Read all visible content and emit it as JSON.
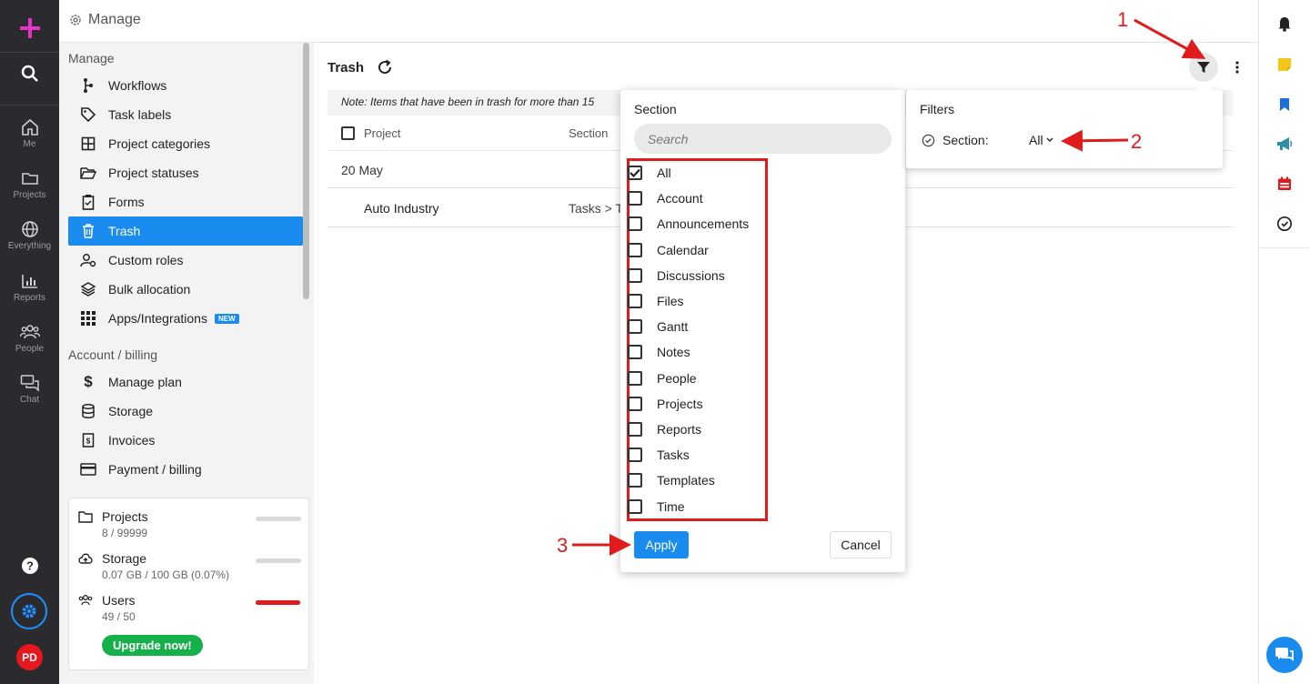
{
  "topbar": {
    "title": "Manage"
  },
  "rail": {
    "items": [
      {
        "label": "Me",
        "icon": "home-icon"
      },
      {
        "label": "Projects",
        "icon": "folder-icon"
      },
      {
        "label": "Everything",
        "icon": "globe-icon"
      },
      {
        "label": "Reports",
        "icon": "bar-chart-icon"
      },
      {
        "label": "People",
        "icon": "people-icon"
      },
      {
        "label": "Chat",
        "icon": "chat-icon"
      }
    ],
    "avatar": "PD"
  },
  "sidebar": {
    "heading_manage": "Manage",
    "manage_items": [
      {
        "label": "Workflows",
        "icon": "workflow-icon"
      },
      {
        "label": "Task labels",
        "icon": "tag-icon"
      },
      {
        "label": "Project categories",
        "icon": "grid-icon"
      },
      {
        "label": "Project statuses",
        "icon": "folder-open-icon"
      },
      {
        "label": "Forms",
        "icon": "clipboard-icon"
      },
      {
        "label": "Trash",
        "icon": "trash-icon"
      },
      {
        "label": "Custom roles",
        "icon": "user-role-icon"
      },
      {
        "label": "Bulk allocation",
        "icon": "layers-icon"
      },
      {
        "label": "Apps/Integrations",
        "icon": "apps-icon",
        "badge": "NEW"
      }
    ],
    "heading_billing": "Account / billing",
    "billing_items": [
      {
        "label": "Manage plan",
        "icon": "dollar-icon"
      },
      {
        "label": "Storage",
        "icon": "database-icon"
      },
      {
        "label": "Invoices",
        "icon": "invoice-icon"
      },
      {
        "label": "Payment / billing",
        "icon": "credit-card-icon"
      }
    ],
    "usage": {
      "projects": {
        "label": "Projects",
        "value": "8 / 99999",
        "fill": 0.0001
      },
      "storage": {
        "label": "Storage",
        "value": "0.07 GB / 100 GB (0.07%)",
        "fill": 0.0007
      },
      "users": {
        "label": "Users",
        "value": "49 / 50",
        "fill": 0.98
      },
      "upgrade": "Upgrade now!"
    }
  },
  "main": {
    "title": "Trash",
    "note": "Note: Items that have been in trash for more than 15",
    "columns": [
      "Project",
      "Section"
    ],
    "group": "20 May",
    "rows": [
      {
        "project": "Auto Industry",
        "section": "Tasks > T"
      }
    ]
  },
  "section_dropdown": {
    "title": "Section",
    "search_placeholder": "Search",
    "options": [
      {
        "label": "All",
        "checked": true
      },
      {
        "label": "Account",
        "checked": false
      },
      {
        "label": "Announcements",
        "checked": false
      },
      {
        "label": "Calendar",
        "checked": false
      },
      {
        "label": "Discussions",
        "checked": false
      },
      {
        "label": "Files",
        "checked": false
      },
      {
        "label": "Gantt",
        "checked": false
      },
      {
        "label": "Notes",
        "checked": false
      },
      {
        "label": "People",
        "checked": false
      },
      {
        "label": "Projects",
        "checked": false
      },
      {
        "label": "Reports",
        "checked": false
      },
      {
        "label": "Tasks",
        "checked": false
      },
      {
        "label": "Templates",
        "checked": false
      },
      {
        "label": "Time",
        "checked": false
      }
    ],
    "apply": "Apply",
    "cancel": "Cancel"
  },
  "filters": {
    "title": "Filters",
    "section_label": "Section:",
    "section_value": "All"
  },
  "annotations": {
    "n1": "1",
    "n2": "2",
    "n3": "3",
    "color": "#e01b1b"
  },
  "colors": {
    "accent": "#1a8cf0",
    "rail": "#2b2b2f",
    "brand_plus": "#e535c8",
    "upgrade": "#16b04b",
    "danger": "#e01b1b"
  }
}
